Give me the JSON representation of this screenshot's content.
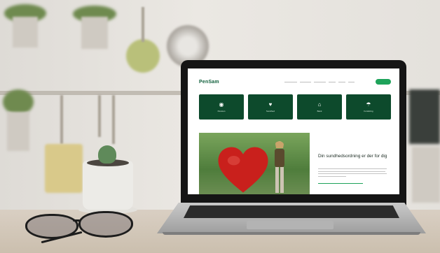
{
  "site": {
    "logo": "PenSam",
    "nav_items": [
      "",
      "",
      "",
      "",
      "",
      ""
    ],
    "cta_label": "",
    "tiles": [
      {
        "label": "Pension",
        "icon": "piggy-bank-icon"
      },
      {
        "label": "Sundhed",
        "icon": "heart-pulse-icon"
      },
      {
        "label": "Bank",
        "icon": "bank-building-icon"
      },
      {
        "label": "Forsikring",
        "icon": "umbrella-icon"
      }
    ],
    "hero": {
      "title": "Din sundhedsordning er der for dig",
      "body": "",
      "link": ""
    }
  },
  "colors": {
    "brand_green": "#0d4a2c",
    "accent_green": "#1ea35a",
    "heart_red": "#c9201c"
  }
}
